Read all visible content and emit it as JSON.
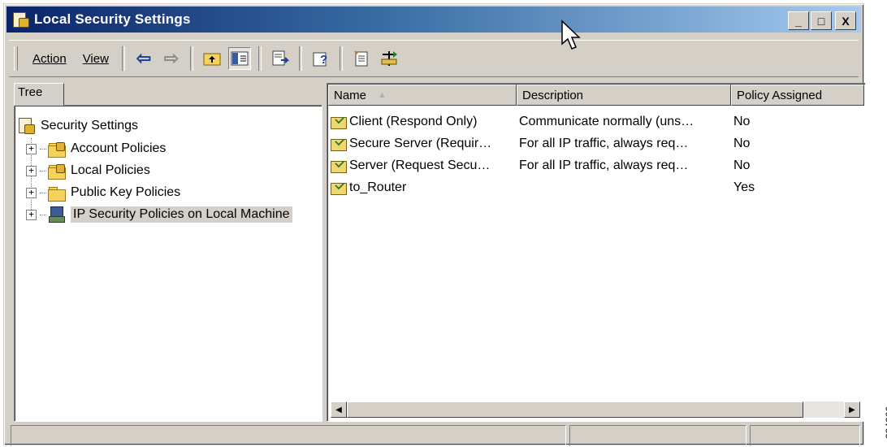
{
  "window": {
    "title": "Local Security Settings",
    "buttons": [
      "_",
      "□",
      "X"
    ]
  },
  "toolbar": {
    "action_label": "Action",
    "view_label": "View",
    "icons": [
      "back-arrow-icon",
      "forward-arrow-icon",
      "up-folder-icon",
      "show-tree-icon",
      "export-list-icon",
      "help-icon",
      "new-policy-icon",
      "manage-filters-icon"
    ]
  },
  "tree": {
    "tab_label": "Tree",
    "root": "Security Settings",
    "items": [
      {
        "label": "Account Policies"
      },
      {
        "label": "Local Policies"
      },
      {
        "label": "Public Key Policies"
      },
      {
        "label": "IP Security Policies on Local Machine",
        "selected": true
      }
    ]
  },
  "list": {
    "columns": [
      "Name",
      "Description",
      "Policy Assigned"
    ],
    "rows": [
      {
        "name": "Client (Respond Only)",
        "description": "Communicate normally (uns…",
        "assigned": "No"
      },
      {
        "name": "Secure Server (Requir…",
        "description": "For all IP traffic, always req…",
        "assigned": "No"
      },
      {
        "name": "Server (Request Secu…",
        "description": "For all IP traffic, always req…",
        "assigned": "No"
      },
      {
        "name": "to_Router",
        "description": "",
        "assigned": "Yes"
      }
    ]
  },
  "figure_number": "234266",
  "colors": {
    "titlebar_start": "#0a246a",
    "titlebar_end": "#a6caf0",
    "chrome": "#d4d0c8"
  }
}
